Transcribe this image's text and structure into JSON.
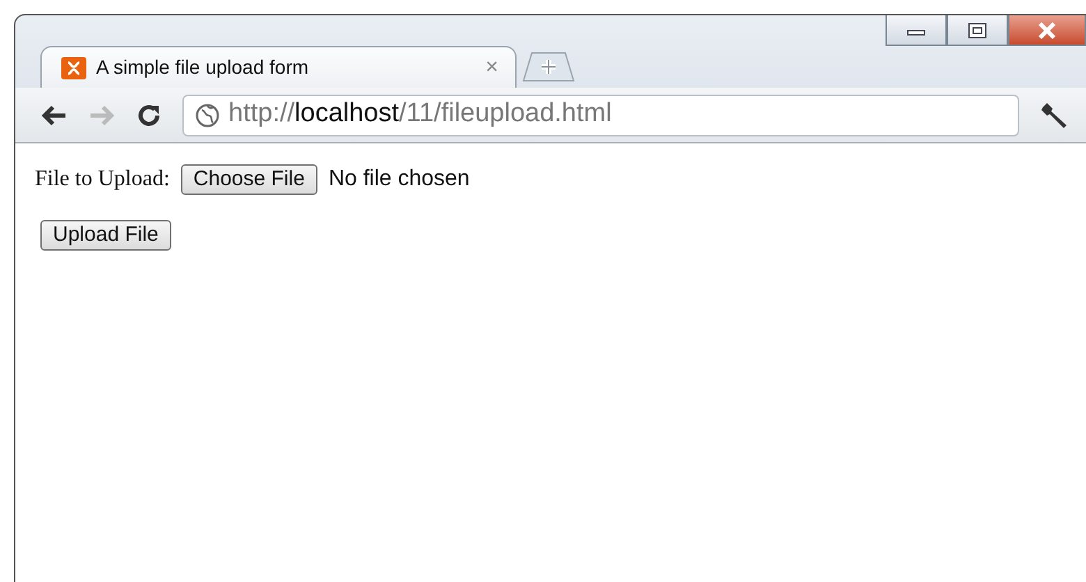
{
  "tabs": [
    {
      "title": "A simple file upload form",
      "close": "×",
      "selected": true
    }
  ],
  "address": {
    "scheme": "http://",
    "host": "localhost",
    "path": "/11/fileupload.html"
  },
  "nav": {
    "back_disabled": false,
    "forward_disabled": true
  },
  "form": {
    "label": "File to Upload:",
    "choose_button": "Choose File",
    "file_status": "No file chosen",
    "submit_button": "Upload File"
  }
}
